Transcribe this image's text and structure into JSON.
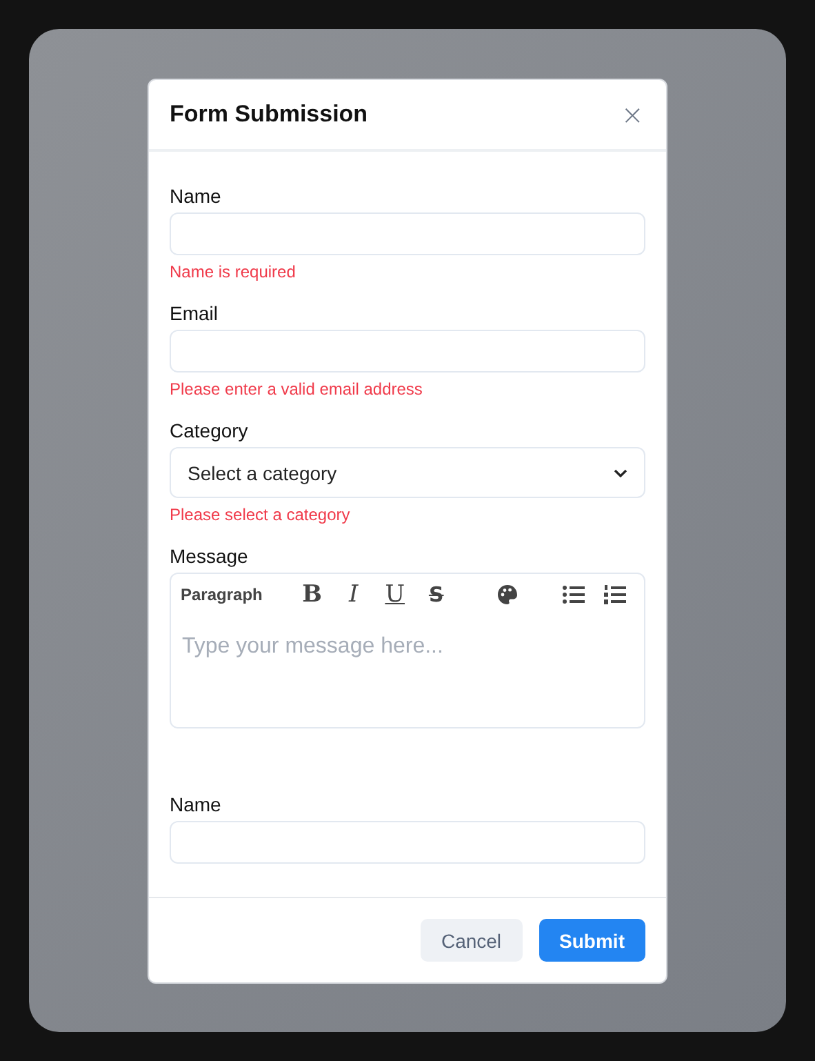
{
  "dialog": {
    "title": "Form Submission",
    "close": "×"
  },
  "fields": [
    {
      "kind": "text",
      "label": "Name",
      "error": "Name is required"
    },
    {
      "kind": "text",
      "label": "Email",
      "error": "Please enter a valid email address"
    },
    {
      "kind": "select",
      "label": "Category",
      "value": "Select a category",
      "error": "Please select a category"
    },
    {
      "kind": "editor",
      "label": "Message",
      "placeholder": "Type your message here...",
      "toolbar": [
        {
          "kind": "format",
          "label": "Paragraph"
        },
        {
          "kind": "bold",
          "label": "B"
        },
        {
          "kind": "italic",
          "label": "I"
        },
        {
          "kind": "underline",
          "label": "U"
        },
        {
          "kind": "strike",
          "label": "S"
        },
        {
          "kind": "color"
        },
        {
          "kind": "bullets"
        },
        {
          "kind": "numbers"
        }
      ]
    },
    {
      "kind": "text",
      "label": "Name"
    }
  ],
  "buttons": [
    {
      "kind": "secondary",
      "label": "Cancel"
    },
    {
      "kind": "primary",
      "label": "Submit"
    }
  ]
}
